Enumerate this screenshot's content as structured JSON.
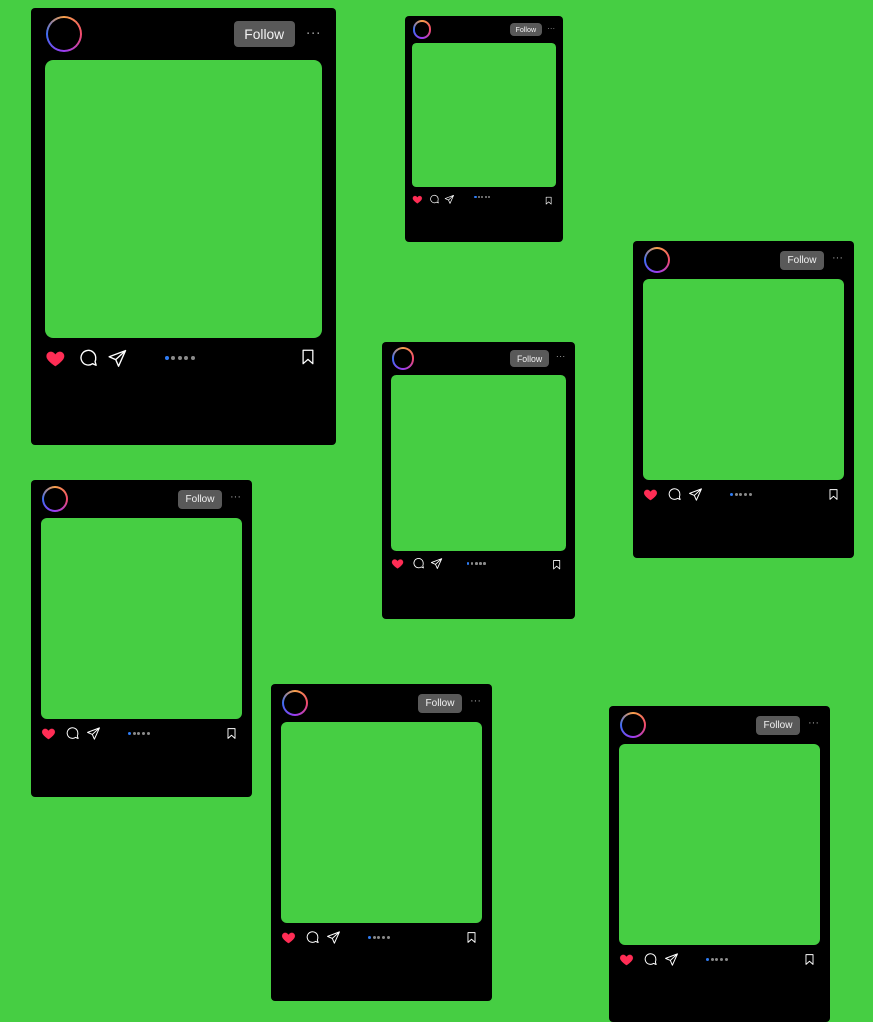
{
  "background_color": "#46CE43",
  "accent_colors": {
    "like": "#FF2D55",
    "active_dot": "#2F7DF5",
    "follow_button": "#595959",
    "card": "#000000"
  },
  "post": {
    "follow_label": "Follow",
    "more_label": "···"
  },
  "icons": [
    "avatar-ring",
    "heart-icon",
    "comment-icon",
    "share-icon",
    "bookmark-icon",
    "more-icon"
  ],
  "posts": [
    {
      "carousel_dots": 5,
      "active_dot": 1
    },
    {
      "carousel_dots": 5,
      "active_dot": 1
    },
    {
      "carousel_dots": 5,
      "active_dot": 1
    },
    {
      "carousel_dots": 5,
      "active_dot": 1
    },
    {
      "carousel_dots": 5,
      "active_dot": 1
    },
    {
      "carousel_dots": 5,
      "active_dot": 1
    },
    {
      "carousel_dots": 5,
      "active_dot": 1
    }
  ]
}
